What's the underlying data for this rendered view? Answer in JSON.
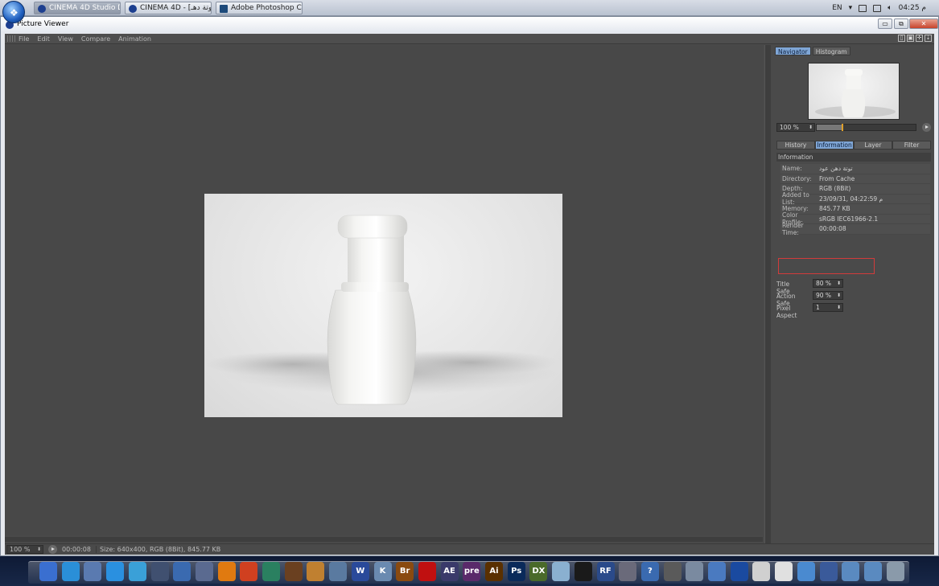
{
  "taskbar": {
    "buttons": [
      {
        "label": "CINEMA 4D Studio D..."
      },
      {
        "label": "CINEMA 4D - [توتة دهـ]..."
      },
      {
        "label": "Adobe Photoshop C..."
      }
    ],
    "lang": "EN",
    "clock": "04:25 م"
  },
  "window": {
    "title": "Picture Viewer",
    "minimize": "▭",
    "restore": "⧉",
    "close": "✕"
  },
  "menu": {
    "items": [
      "File",
      "Edit",
      "View",
      "Compare",
      "Animation"
    ]
  },
  "panel": {
    "tabs": [
      "Navigator",
      "Histogram"
    ],
    "nav_zoom": "100 %",
    "info_tabs": [
      "History",
      "Information",
      "Layer",
      "Filter"
    ],
    "info_title": "Information",
    "info": [
      {
        "key": "Name:",
        "value": "توتة دهن عود"
      },
      {
        "key": "Directory:",
        "value": "From Cache"
      },
      {
        "key": "Depth:",
        "value": "RGB (8Bit)"
      },
      {
        "key": "Added to List:",
        "value": "23/09/31, 04:22:59 م"
      },
      {
        "key": "Memory:",
        "value": "845.77 KB"
      },
      {
        "key": "Color Profile:",
        "value": "sRGB IEC61966-2.1"
      },
      {
        "key": "Render Time:",
        "value": "00:00:08"
      }
    ],
    "settings": [
      {
        "label": "Title Safe",
        "value": "80 %"
      },
      {
        "label": "Action Safe",
        "value": "90 %"
      },
      {
        "label": "Pixel Aspect",
        "value": "1"
      }
    ]
  },
  "status": {
    "zoom": "100 %",
    "time": "00:00:08",
    "size": "Size: 640x400, RGB (8Bit), 845.77 KB"
  },
  "dock": {
    "icons": [
      {
        "name": "finder",
        "color": "#3a6fd0",
        "text": ""
      },
      {
        "name": "safari",
        "color": "#2a8fd8",
        "text": ""
      },
      {
        "name": "mail",
        "color": "#5a7ab0",
        "text": ""
      },
      {
        "name": "facetime",
        "color": "#2a90e0",
        "text": ""
      },
      {
        "name": "files",
        "color": "#3aa0d8",
        "text": ""
      },
      {
        "name": "imovie",
        "color": "#405070",
        "text": ""
      },
      {
        "name": "monitor",
        "color": "#3a6ab0",
        "text": ""
      },
      {
        "name": "itunes",
        "color": "#5a6a90",
        "text": ""
      },
      {
        "name": "vlc",
        "color": "#e07a10",
        "text": ""
      },
      {
        "name": "ccleaner",
        "color": "#d04020",
        "text": ""
      },
      {
        "name": "feather",
        "color": "#2a8060",
        "text": ""
      },
      {
        "name": "wizard",
        "color": "#6a4020",
        "text": ""
      },
      {
        "name": "preview",
        "color": "#c08030",
        "text": ""
      },
      {
        "name": "stamp",
        "color": "#5a7aa0",
        "text": ""
      },
      {
        "name": "word",
        "color": "#2a4a9a",
        "text": "W"
      },
      {
        "name": "kdiff",
        "color": "#6a8ab0",
        "text": "K"
      },
      {
        "name": "bridge",
        "color": "#8a4a10",
        "text": "Br"
      },
      {
        "name": "acrobat",
        "color": "#c01010",
        "text": ""
      },
      {
        "name": "after-effects",
        "color": "#3a3a6a",
        "text": "AE"
      },
      {
        "name": "premiere",
        "color": "#5a2a6a",
        "text": "pre"
      },
      {
        "name": "illustrator",
        "color": "#5a3000",
        "text": "Ai"
      },
      {
        "name": "photoshop",
        "color": "#0a2a5a",
        "text": "Ps"
      },
      {
        "name": "dx",
        "color": "#4a6a2a",
        "text": "DX"
      },
      {
        "name": "cloud",
        "color": "#8ab0d0",
        "text": ""
      },
      {
        "name": "zbrush",
        "color": "#1a1a1a",
        "text": ""
      },
      {
        "name": "realflow",
        "color": "#2a4a8a",
        "text": "RF"
      },
      {
        "name": "tool",
        "color": "#6a6a7a",
        "text": ""
      },
      {
        "name": "help",
        "color": "#3a6ab0",
        "text": "?"
      },
      {
        "name": "settings",
        "color": "#5a5a5a",
        "text": ""
      },
      {
        "name": "calculator",
        "color": "#7a8aa0",
        "text": ""
      },
      {
        "name": "finder-2",
        "color": "#4a7ac0",
        "text": ""
      },
      {
        "name": "globe",
        "color": "#1a4aa0",
        "text": ""
      },
      {
        "name": "notes",
        "color": "#d0d0d0",
        "text": ""
      },
      {
        "name": "document",
        "color": "#e0e0e0",
        "text": ""
      },
      {
        "name": "blue-doc",
        "color": "#4a8ad0",
        "text": ""
      },
      {
        "name": "building",
        "color": "#3a5a9a",
        "text": ""
      },
      {
        "name": "folder-1",
        "color": "#5a8ac0",
        "text": ""
      },
      {
        "name": "folder-2",
        "color": "#5a8ac0",
        "text": ""
      },
      {
        "name": "trash",
        "color": "#8a9aaa",
        "text": ""
      }
    ]
  }
}
